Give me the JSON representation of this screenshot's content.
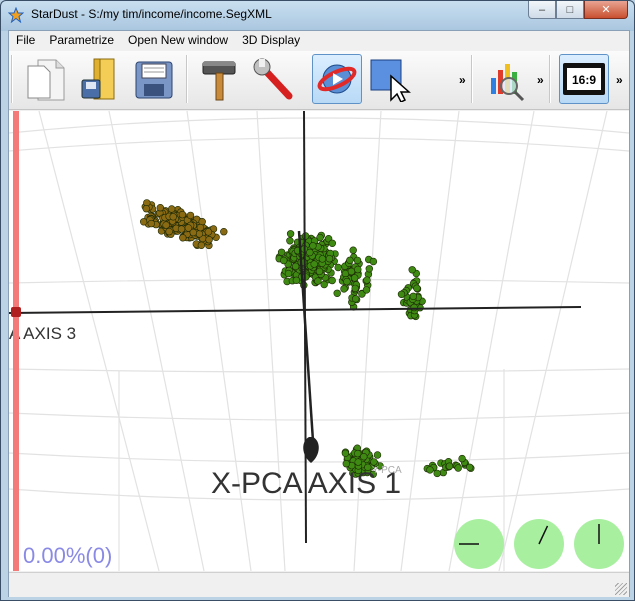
{
  "window": {
    "title": "StarDust - S:/my tim/income/income.SegXML",
    "controls": {
      "minimize": "–",
      "maximize": "□",
      "close": "✕"
    }
  },
  "menu": [
    {
      "id": "file",
      "label": "File"
    },
    {
      "id": "parametrize",
      "label": "Parametrize"
    },
    {
      "id": "open-new-window",
      "label": "Open New window"
    },
    {
      "id": "3d-display",
      "label": "3D Display"
    }
  ],
  "toolbar": {
    "icons": [
      "new-document-icon",
      "open-folder-icon",
      "save-disk-icon",
      "hammer-icon",
      "wrench-icon",
      "rotate-3d-icon",
      "select-pointer-icon",
      "chart-magnify-icon",
      "aspect-ratio-icon"
    ],
    "chevron": "»",
    "aspect_label": "16:9"
  },
  "viewport": {
    "axis_x_label": "X-PCA AXIS 1",
    "axis_side_label": "A AXIS 3",
    "axis_small_label": "Y-PCA",
    "percent_readout": "0.00%(0)",
    "colors": {
      "brown": "#8b6a14",
      "green": "#3f8a12",
      "dial": "#a8f0a0",
      "percent": "#8a8ae6",
      "slider": "#f47a7a"
    },
    "dials": [
      {
        "angle_deg": 270
      },
      {
        "angle_deg": 25
      },
      {
        "angle_deg": 0
      }
    ]
  }
}
